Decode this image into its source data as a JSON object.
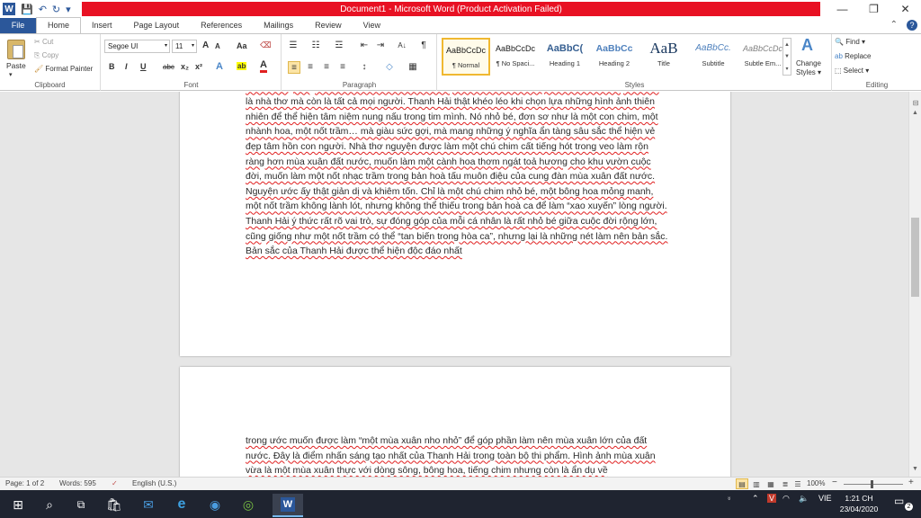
{
  "title_bar": {
    "title": "Document1 - Microsoft Word (Product Activation Failed)",
    "help": "?",
    "minimize": "—",
    "maximize": "❐",
    "close": "✕"
  },
  "qat": {
    "app_glyph": "W",
    "save_glyph": "💾",
    "undo_glyph": "↶",
    "redo_glyph": "↻",
    "more_glyph": "▾"
  },
  "tabs": [
    "File",
    "Home",
    "Insert",
    "Page Layout",
    "References",
    "Mailings",
    "Review",
    "View"
  ],
  "tabs_right": {
    "collapse": "⌃",
    "help": "?"
  },
  "ribbon": {
    "clipboard": {
      "paste": "Paste",
      "cut": "Cut",
      "copy": "Copy",
      "format_painter": "Format Painter",
      "label": "Clipboard"
    },
    "font": {
      "family": "Segoe UI",
      "size": "11",
      "grow": "A",
      "shrink": "A",
      "change_case": "Aa",
      "clear": "⌫",
      "bold": "B",
      "italic": "I",
      "underline": "U",
      "strike": "abc",
      "subscript": "x₂",
      "superscript": "x²",
      "text_effects": "A",
      "highlight": "ab",
      "font_color": "A",
      "label": "Font"
    },
    "paragraph": {
      "bullets": "☰",
      "numbering": "☷",
      "multilevel": "☲",
      "decrease_indent": "⇤",
      "increase_indent": "⇥",
      "sort": "A↓",
      "pilcrow": "¶",
      "align_left": "≡",
      "align_center": "≡",
      "align_right": "≡",
      "justify": "≡",
      "line_spacing": "↕",
      "shading": "◇",
      "borders": "▦",
      "label": "Paragraph"
    },
    "styles": {
      "items": [
        {
          "sample": "AaBbCcDc",
          "name": "¶ Normal"
        },
        {
          "sample": "AaBbCcDc",
          "name": "¶ No Spaci..."
        },
        {
          "sample": "AaBbC(",
          "name": "Heading 1"
        },
        {
          "sample": "AaBbCc",
          "name": "Heading 2"
        },
        {
          "sample": "AaB",
          "name": "Title"
        },
        {
          "sample": "AaBbCc.",
          "name": "Subtitle"
        },
        {
          "sample": "AaBbCcDc",
          "name": "Subtle Em..."
        }
      ],
      "change_styles": "Change Styles ▾",
      "change_glyph": "A",
      "gallery_up": "▲",
      "gallery_down": "▼",
      "gallery_more": "▾",
      "label": "Styles"
    },
    "editing": {
      "find": "Find ▾",
      "replace": "Replace",
      "select": "Select ▾",
      "find_glyph": "🔍",
      "replace_glyph": "ab",
      "select_glyph": "⬚",
      "label": "Editing"
    }
  },
  "document": {
    "para1": "đây ý nghĩa. Nếu nhà “tôi” chỉ một cá nhân, một con người cụ thể, khiến hợp để bày tỏ những cảm xúc, những rung cảm cá nhân thì “ta” lại thích hợp với tâm thế hòa nhập, sẻ chia “ta” ở đây đâu chỉ là nhà thơ mà còn là tất cả mọi người. Thanh Hải thật khéo léo khi chọn lựa những hình ảnh thiên nhiên để thể hiện tâm niệm nung nấu trong tim mình. Nó nhỏ bé, đơn sơ như là một con chim, một nhành hoa, một nốt trầm… mà giàu sức gợi, mà mang những ý nghĩa ẩn tàng sâu sắc thể hiện vẻ đẹp tâm hồn con người. Nhà thơ nguyện được làm một chú chim cất tiếng hót trong veo làm rộn ràng hơn mùa xuân đất nước, muốn làm một cành hoa thơm ngát toả hương cho khu vườn cuộc đời, muốn làm một nốt nhạc trầm trong bản hoà tấu muôn điệu của cung đàn mùa xuân đất nước. Nguyện ước ấy thật giản dị và khiêm tốn. Chỉ là một chú chim nhỏ bé, một bông hoa mỏng manh, một nốt trầm không lành lót, nhưng không thể thiếu trong bản hoà ca để làm “xao xuyến” lòng người. Thanh Hải ý thức rất rõ vai trò, sự đóng góp của mỗi cá nhân là rất nhỏ bé giữa cuộc đời rộng lớn, cũng giống như một nốt trầm có thể “tan biến trong hòa ca”, nhưng lại là những nét làm nên bản sắc. Bản sắc của Thanh Hải được thể hiện độc đáo nhất",
    "para2": "trong ước muốn được làm “một mùa xuân nho nhỏ” để góp phần làm nên mùa xuân lớn của đất nước. Đây là điểm nhấn sáng tạo nhất của Thanh Hải trong toàn bộ thi phẩm. Hình ảnh mùa xuân vừa là một mùa xuân thực với dòng sông, bông hoa, tiếng chim nhưng còn là ẩn dụ về"
  },
  "scrollbar": {
    "ruler": "⊟",
    "up": "▲",
    "down": "▼"
  },
  "status_bar": {
    "page": "Page: 1 of 2",
    "words": "Words: 595",
    "proof": "✓",
    "language": "English (U.S.)",
    "zoom": "100%",
    "zoom_out": "−",
    "zoom_in": "+",
    "view_print": "▤",
    "view_read": "▥",
    "view_web": "▦",
    "view_outline": "≣",
    "view_draft": "☰"
  },
  "taskbar": {
    "start": "⊞",
    "search": "⌕",
    "taskview": "⧉",
    "store": "🛍",
    "mail": "✉",
    "edge": "e",
    "chrome": "◉",
    "app6": "◎",
    "word": "W",
    "people": "⍤",
    "tray_up": "⌃",
    "antivirus": "V",
    "wifi": "◠",
    "volume": "🔈",
    "language": "VIE",
    "time": "1:21 CH",
    "date": "23/04/2020",
    "notifications": "▭",
    "notif_count": "2"
  }
}
